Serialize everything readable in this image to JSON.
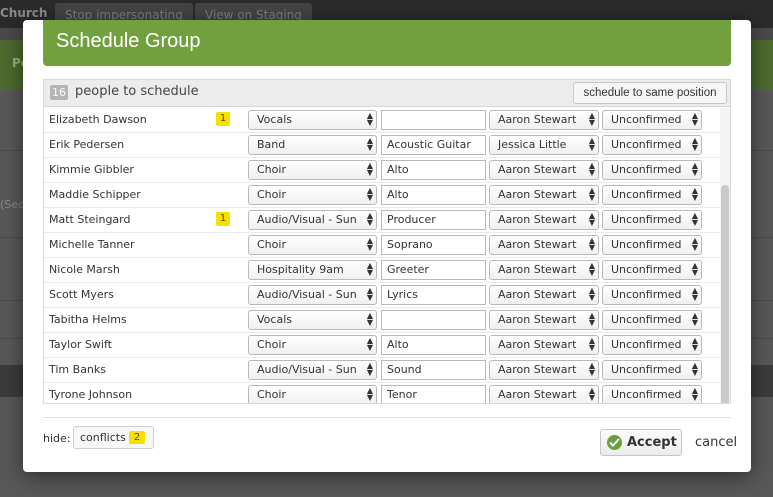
{
  "background": {
    "org_name": "Church",
    "stop_impersonating": "Stop impersonating",
    "view_on_staging": "View on Staging",
    "green_bar_text": "Pe",
    "side_text": "(Sec"
  },
  "modal": {
    "title": "Schedule Group",
    "people_count": "16",
    "people_label": "people to schedule",
    "same_position_button": "schedule to same position",
    "rows": [
      {
        "name": "Elizabeth Dawson",
        "conflicts": "1",
        "team": "Vocals",
        "position": "",
        "leader": "Aaron Stewart",
        "status": "Unconfirmed"
      },
      {
        "name": "Erik Pedersen",
        "conflicts": "",
        "team": "Band",
        "position": "Acoustic Guitar",
        "leader": "Jessica Little",
        "status": "Unconfirmed"
      },
      {
        "name": "Kimmie Gibbler",
        "conflicts": "",
        "team": "Choir",
        "position": "Alto",
        "leader": "Aaron Stewart",
        "status": "Unconfirmed"
      },
      {
        "name": "Maddie Schipper",
        "conflicts": "",
        "team": "Choir",
        "position": "Alto",
        "leader": "Aaron Stewart",
        "status": "Unconfirmed"
      },
      {
        "name": "Matt Steingard",
        "conflicts": "1",
        "team": "Audio/Visual - Sun",
        "position": "Producer",
        "leader": "Aaron Stewart",
        "status": "Unconfirmed"
      },
      {
        "name": "Michelle Tanner",
        "conflicts": "",
        "team": "Choir",
        "position": "Soprano",
        "leader": "Aaron Stewart",
        "status": "Unconfirmed"
      },
      {
        "name": "Nicole Marsh",
        "conflicts": "",
        "team": "Hospitality 9am",
        "position": "Greeter",
        "leader": "Aaron Stewart",
        "status": "Unconfirmed"
      },
      {
        "name": "Scott Myers",
        "conflicts": "",
        "team": "Audio/Visual - Sun",
        "position": "Lyrics",
        "leader": "Aaron Stewart",
        "status": "Unconfirmed"
      },
      {
        "name": "Tabitha Helms",
        "conflicts": "",
        "team": "Vocals",
        "position": "",
        "leader": "Aaron Stewart",
        "status": "Unconfirmed"
      },
      {
        "name": "Taylor Swift",
        "conflicts": "",
        "team": "Choir",
        "position": "Alto",
        "leader": "Aaron Stewart",
        "status": "Unconfirmed"
      },
      {
        "name": "Tim Banks",
        "conflicts": "",
        "team": "Audio/Visual - Sun",
        "position": "Sound",
        "leader": "Aaron Stewart",
        "status": "Unconfirmed"
      },
      {
        "name": "Tyrone Johnson",
        "conflicts": "",
        "team": "Choir",
        "position": "Tenor",
        "leader": "Aaron Stewart",
        "status": "Unconfirmed"
      }
    ],
    "hide_label": "hide:",
    "conflicts_label": "conflicts",
    "conflicts_count": "2",
    "accept_label": "Accept",
    "cancel_label": "cancel"
  },
  "colors": {
    "header_green": "#73a03e",
    "conflict_yellow": "#f6e000",
    "accept_check_green": "#6aa03a"
  }
}
